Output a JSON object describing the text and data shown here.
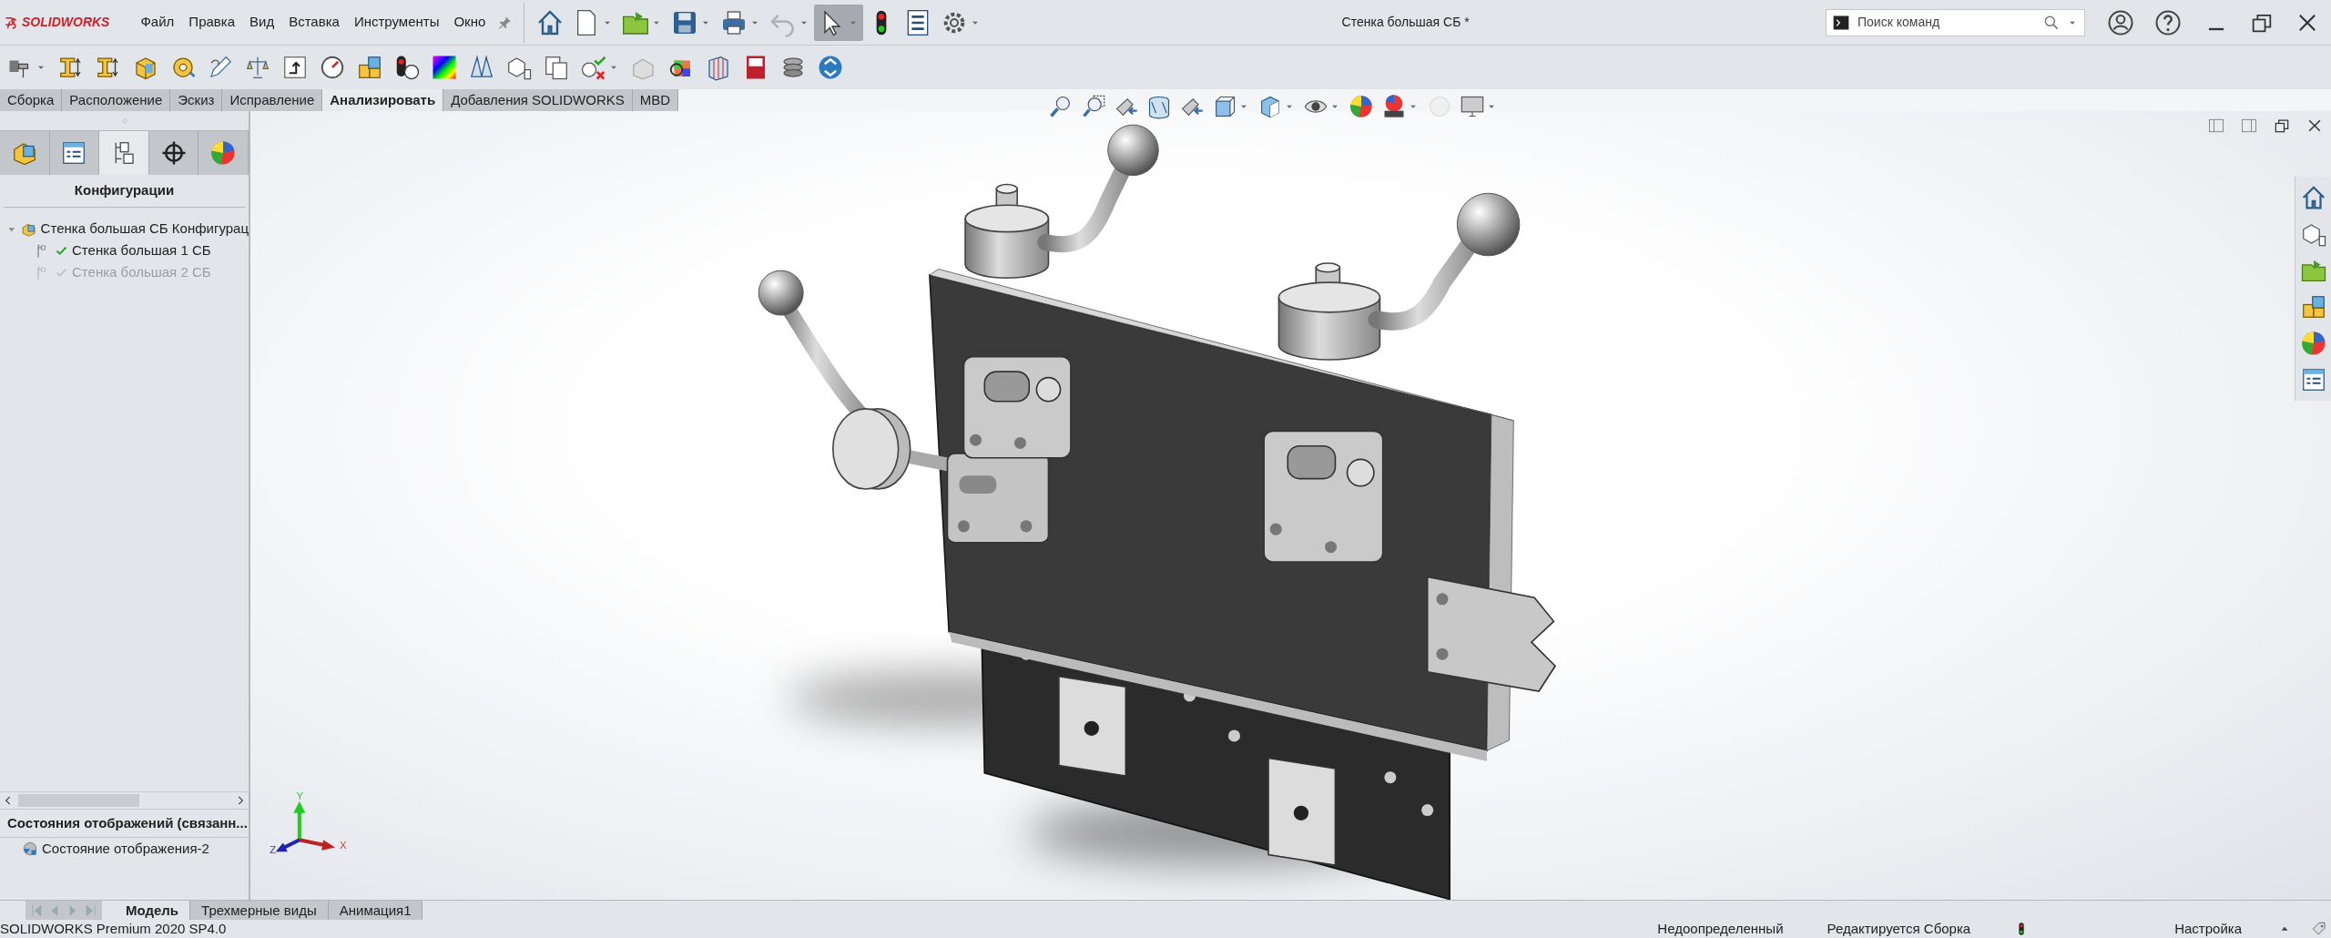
{
  "app": {
    "logo": "SOLIDWORKS",
    "menu": [
      "Файл",
      "Правка",
      "Вид",
      "Вставка",
      "Инструменты",
      "Окно"
    ],
    "document_title": "Стенка большая СБ *",
    "search": {
      "placeholder": "Поиск команд"
    }
  },
  "command_tabs": [
    {
      "label": "Сборка",
      "selected": false
    },
    {
      "label": "Расположение",
      "selected": false
    },
    {
      "label": "Эскиз",
      "selected": false
    },
    {
      "label": "Исправление",
      "selected": false
    },
    {
      "label": "Анализировать",
      "selected": true
    },
    {
      "label": "Добавления SOLIDWORKS",
      "selected": false
    },
    {
      "label": "MBD",
      "selected": false
    }
  ],
  "left_panel": {
    "tabs": [
      {
        "selected": false
      },
      {
        "selected": false
      },
      {
        "selected": true
      },
      {
        "selected": false
      },
      {
        "selected": false
      }
    ],
    "title": "Конфигурации",
    "tree": [
      {
        "label": "Стенка большая СБ Конфигурац",
        "expanded": true,
        "children": [
          {
            "label": "Стенка большая 1 СБ",
            "active": true
          },
          {
            "label": "Стенка большая 2 СБ",
            "active": false
          }
        ]
      }
    ],
    "display_states": {
      "title": "Состояния отображений (связанн...",
      "items": [
        "Состояние отображения-2"
      ]
    }
  },
  "viewport": {
    "axes": {
      "x": "X",
      "y": "Y",
      "z": "Z"
    }
  },
  "bottom_tabs": [
    {
      "label": "Модель",
      "selected": true
    },
    {
      "label": "Трехмерные виды",
      "selected": false
    },
    {
      "label": "Анимация1",
      "selected": false
    }
  ],
  "status_bar": {
    "product": "SOLIDWORKS Premium 2020 SP4.0",
    "items": [
      "Недоопределенный",
      "Редактируется Сборка"
    ],
    "units": "Настройка"
  }
}
